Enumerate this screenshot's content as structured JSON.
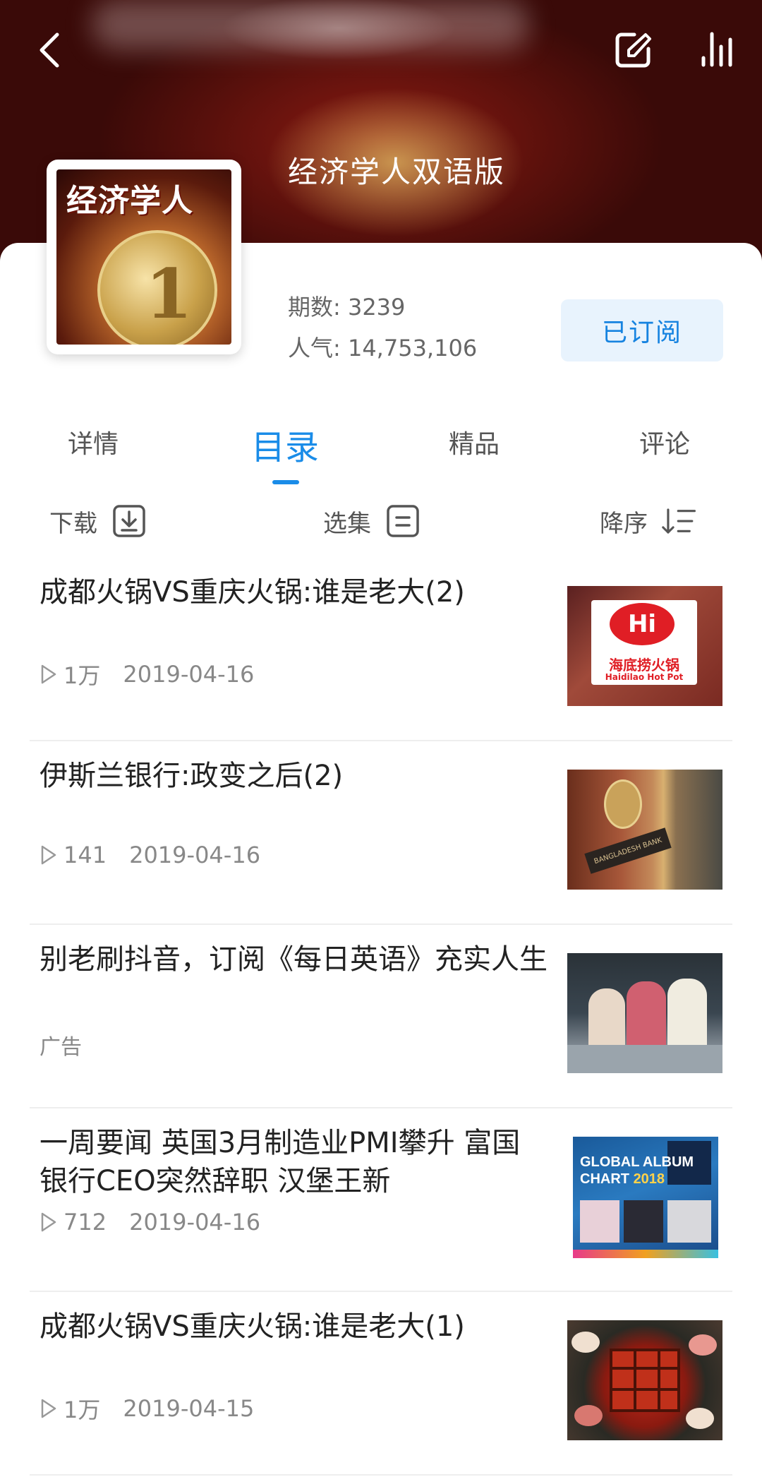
{
  "header": {
    "album_title": "经济学人双语版",
    "cover_logo_text": "经济学人"
  },
  "stats": {
    "issues_label": "期数: 3239",
    "popularity_label": "人气: 14,753,106"
  },
  "subscribe_label": "已订阅",
  "tabs": [
    {
      "label": "详情"
    },
    {
      "label": "目录",
      "active": true
    },
    {
      "label": "精品"
    },
    {
      "label": "评论"
    }
  ],
  "toolbar": {
    "download_label": "下载",
    "select_label": "选集",
    "sort_label": "降序"
  },
  "episodes": [
    {
      "title": "成都火锅VS重庆火锅:谁是老大(2)",
      "plays": "1万",
      "date": "2019-04-16",
      "thumb_sign_cn": "海底捞火锅",
      "thumb_sign_en": "Haidilao Hot Pot",
      "thumb_logo": "Hi"
    },
    {
      "title": "伊斯兰银行:政变之后(2)",
      "plays": "141",
      "date": "2019-04-16",
      "thumb_plaque": "BANGLADESH BANK"
    },
    {
      "title": "别老刷抖音，订阅《每日英语》充实人生",
      "ad_label": "广告"
    },
    {
      "title": "一周要闻 英国3月制造业PMI攀升 富国银行CEO突然辞职 汉堡王新",
      "plays": "712",
      "date": "2019-04-16",
      "thumb_text_1": "GLOBAL ALBUM",
      "thumb_text_2": "CHART",
      "thumb_year": "2018"
    },
    {
      "title": "成都火锅VS重庆火锅:谁是老大(1)",
      "plays": "1万",
      "date": "2019-04-15"
    }
  ],
  "colors": {
    "accent": "#1a8ce8",
    "subscribe_bg": "#e8f3fd"
  }
}
